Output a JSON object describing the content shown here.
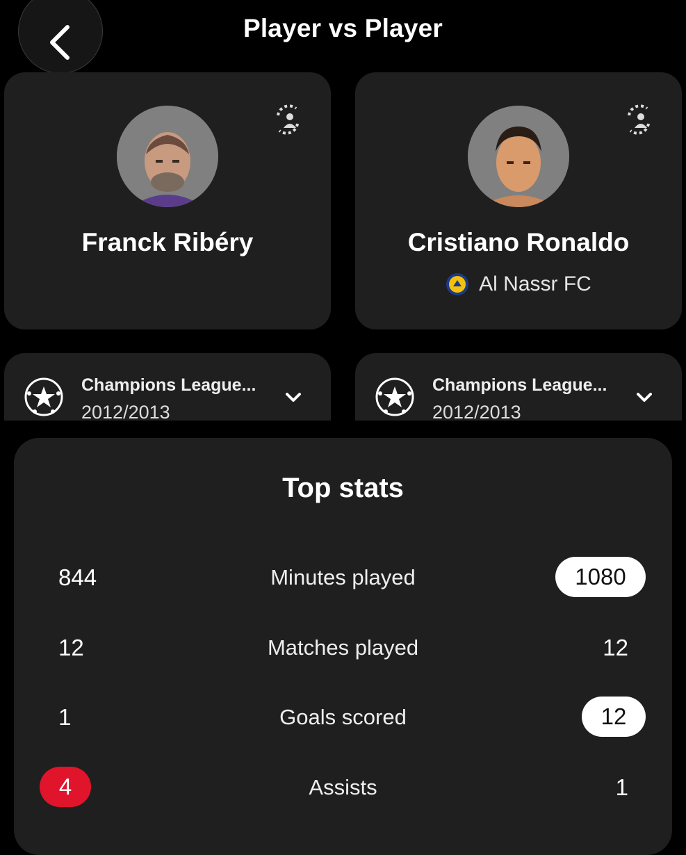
{
  "header": {
    "title": "Player vs Player"
  },
  "players": [
    {
      "name": "Franck Ribéry",
      "club": ""
    },
    {
      "name": "Cristiano Ronaldo",
      "club": "Al Nassr FC"
    }
  ],
  "competitions": [
    {
      "name": "Champions League...",
      "season": "2012/2013"
    },
    {
      "name": "Champions League...",
      "season": "2012/2013"
    }
  ],
  "stats": {
    "title": "Top stats",
    "rows": [
      {
        "label": "Minutes played",
        "left": "844",
        "right": "1080",
        "highlight": "right"
      },
      {
        "label": "Matches played",
        "left": "12",
        "right": "12",
        "highlight": "none"
      },
      {
        "label": "Goals scored",
        "left": "1",
        "right": "12",
        "highlight": "right"
      },
      {
        "label": "Assists",
        "left": "4",
        "right": "1",
        "highlight": "left"
      }
    ]
  },
  "colors": {
    "background": "#000000",
    "card": "#1f1f1f",
    "highlight_white": "#ffffff",
    "highlight_red": "#e0142b"
  }
}
